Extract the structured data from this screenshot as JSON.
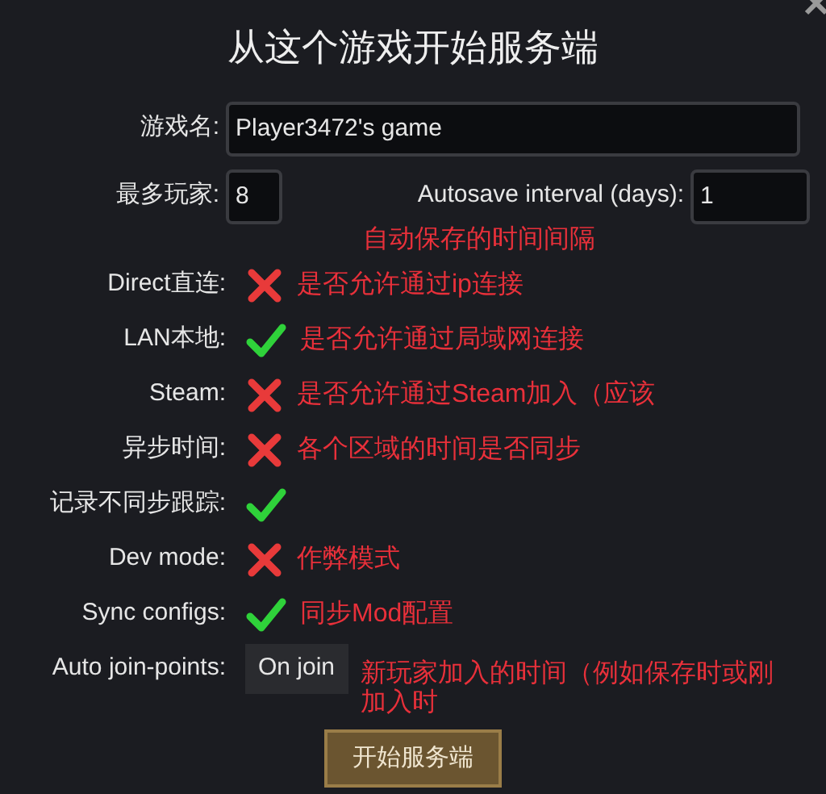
{
  "dialog": {
    "title": "从这个游戏开始服务端"
  },
  "game_name": {
    "label": "游戏名:",
    "value": "Player3472's game"
  },
  "max_players": {
    "label": "最多玩家:",
    "value": "8"
  },
  "autosave": {
    "label": "Autosave interval (days):",
    "value": "1",
    "note": "自动保存的时间间隔"
  },
  "options": [
    {
      "kind": "toggle",
      "label": "Direct直连:",
      "checked": false,
      "note": "是否允许通过ip连接"
    },
    {
      "kind": "toggle",
      "label": "LAN本地:",
      "checked": true,
      "note": "是否允许通过局域网连接"
    },
    {
      "kind": "toggle",
      "label": "Steam:",
      "checked": false,
      "note": "是否允许通过Steam加入（应该"
    },
    {
      "kind": "toggle",
      "label": "异步时间:",
      "checked": false,
      "note": "各个区域的时间是否同步"
    },
    {
      "kind": "toggle",
      "label": "记录不同步跟踪:",
      "checked": true
    },
    {
      "kind": "toggle",
      "label": "Dev mode:",
      "checked": false,
      "note": "作弊模式"
    },
    {
      "kind": "toggle",
      "label": "Sync configs:",
      "checked": true,
      "note": "同步Mod配置"
    },
    {
      "kind": "choice",
      "label": "Auto join-points:",
      "value": "On join",
      "note": "新玩家加入的时间（例如保存时或刚加入时"
    }
  ],
  "start_button": {
    "label": "开始服务端"
  }
}
